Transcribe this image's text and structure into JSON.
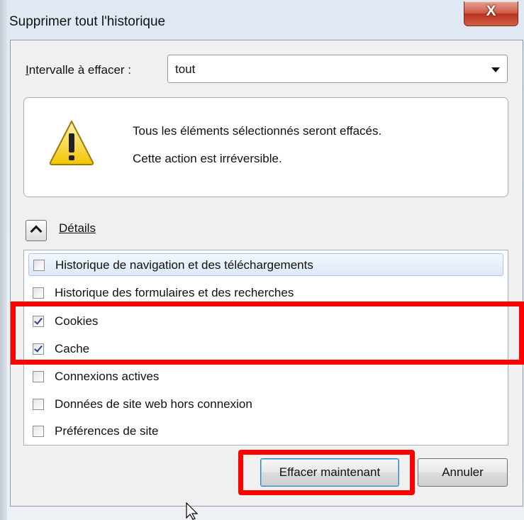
{
  "window": {
    "title": "Supprimer tout l'historique",
    "close_glyph": "X"
  },
  "range": {
    "label_accesskey": "I",
    "label_rest": "ntervalle à effacer :",
    "selected": "tout"
  },
  "warning": {
    "icon": "warning-triangle-icon",
    "line1": "Tous les éléments sélectionnés seront effacés.",
    "line2": "Cette action est irréversible."
  },
  "details": {
    "label": "Détails",
    "expanded": true
  },
  "items": [
    {
      "label": "Historique de navigation et des téléchargements",
      "checked": false
    },
    {
      "label": "Historique des formulaires et des recherches",
      "checked": false
    },
    {
      "label": "Cookies",
      "checked": true
    },
    {
      "label": "Cache",
      "checked": true
    },
    {
      "label": "Connexions actives",
      "checked": false
    },
    {
      "label": "Données de site web hors connexion",
      "checked": false
    },
    {
      "label": "Préférences de site",
      "checked": false
    }
  ],
  "buttons": {
    "clear": "Effacer maintenant",
    "cancel": "Annuler"
  },
  "colors": {
    "highlight": "#ff0000",
    "selected_row": "#dde9f8",
    "check": "#2b3f86"
  }
}
